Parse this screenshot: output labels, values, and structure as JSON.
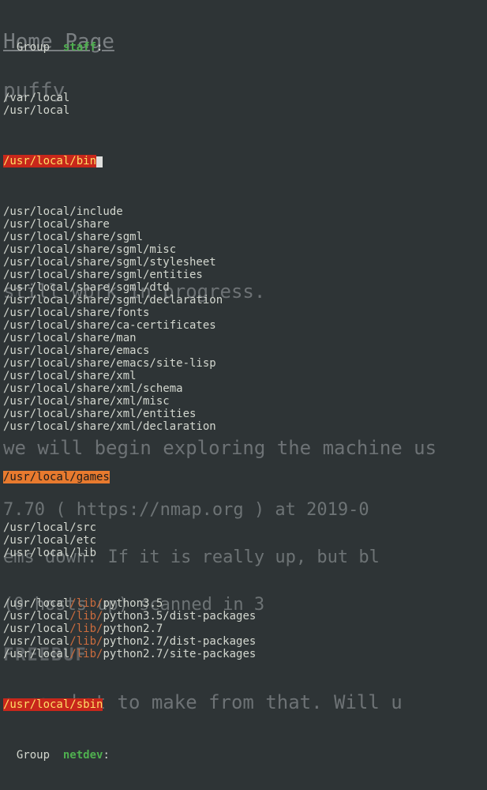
{
  "bg": {
    "h1": "Home Page",
    "h2": "puffy",
    "p1": "still work in progress.",
    "p2": "we will begin exploring the machine us",
    "n1": "7.70 ( https://nmap.org ) at 2019-0",
    "n2": "ems down. If it is really up, but bl",
    "n3": "(0 hosts up) scanned in 3",
    "freebuf": "FREEBUF",
    "p3": "sure what to make from that. Will u"
  },
  "term": {
    "group_label": "Group",
    "group1_name": "staff",
    "group2_name": "netdev",
    "colon": ":",
    "hl_bin": "/usr/local/bin",
    "hl_games": "/usr/local/games",
    "hl_sbin": "/usr/local/sbin",
    "lib_seg": "/lib/",
    "paths_pre": [
      "/var/local",
      "/usr/local"
    ],
    "paths_mid": [
      "/usr/local/include",
      "/usr/local/share",
      "/usr/local/share/sgml",
      "/usr/local/share/sgml/misc",
      "/usr/local/share/sgml/stylesheet",
      "/usr/local/share/sgml/entities",
      "/usr/local/share/sgml/dtd",
      "/usr/local/share/sgml/declaration",
      "/usr/local/share/fonts",
      "/usr/local/share/ca-certificates",
      "/usr/local/share/man",
      "/usr/local/share/emacs",
      "/usr/local/share/emacs/site-lisp",
      "/usr/local/share/xml",
      "/usr/local/share/xml/schema",
      "/usr/local/share/xml/misc",
      "/usr/local/share/xml/entities",
      "/usr/local/share/xml/declaration"
    ],
    "paths_post": [
      "/usr/local/src",
      "/usr/local/etc",
      "/usr/local/lib"
    ],
    "lib_prefix": "/usr/local",
    "lib_entries": [
      "python3.5",
      "python3.5/dist-packages",
      "python2.7",
      "python2.7/dist-packages",
      "python2.7/site-packages"
    ]
  }
}
